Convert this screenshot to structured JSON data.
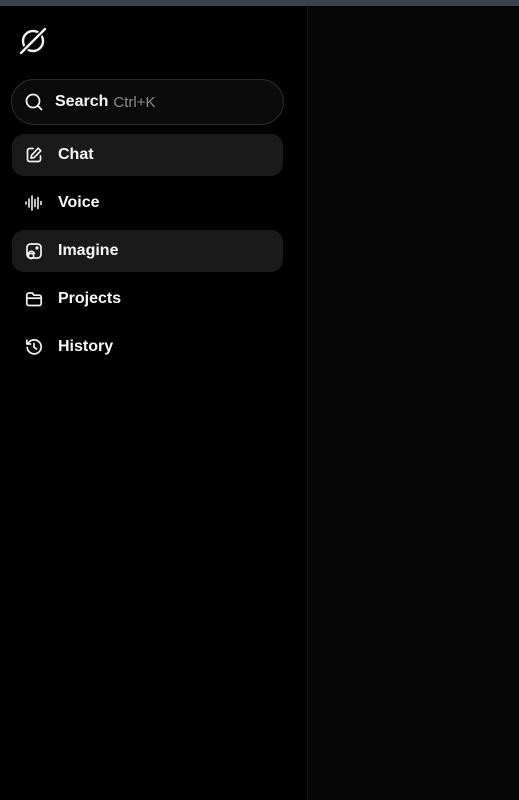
{
  "colors": {
    "background": "#000000",
    "main_background": "#050505",
    "topbar": "#3a414c",
    "active_item_bg": "#1a1a1a",
    "text": "#f7f7f7",
    "muted_text": "#8c8c8c"
  },
  "sidebar": {
    "logo_icon": "grok-logo-icon",
    "search": {
      "label": "Search",
      "shortcut": "Ctrl+K",
      "icon": "search-icon"
    },
    "items": [
      {
        "label": "Chat",
        "icon": "edit-icon",
        "active": true
      },
      {
        "label": "Voice",
        "icon": "waveform-icon",
        "active": false
      },
      {
        "label": "Imagine",
        "icon": "image-icon",
        "active": true
      },
      {
        "label": "Projects",
        "icon": "folder-icon",
        "active": false
      },
      {
        "label": "History",
        "icon": "history-icon",
        "active": false
      }
    ]
  }
}
